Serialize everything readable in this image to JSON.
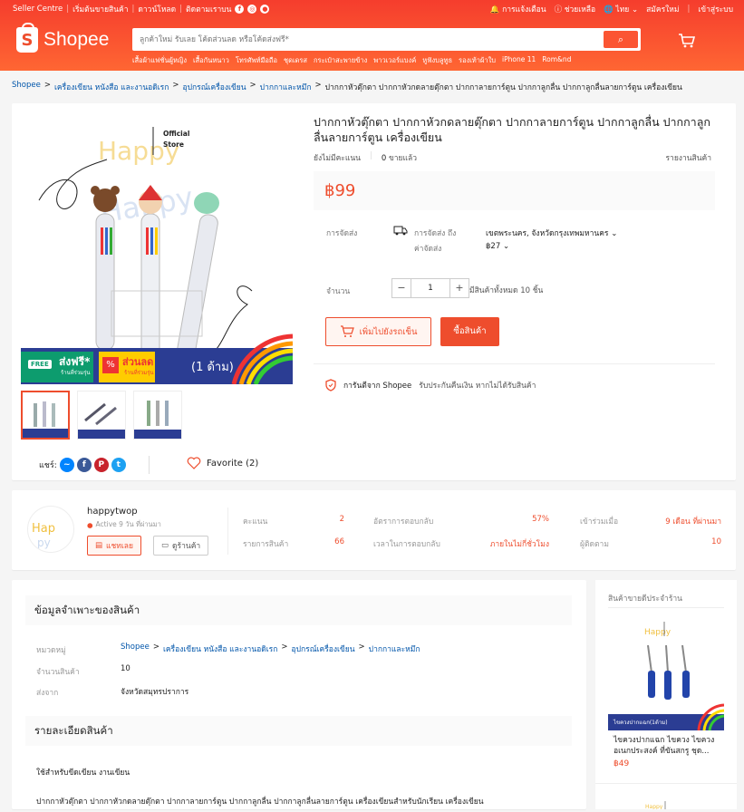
{
  "header": {
    "top_left": [
      "Seller Centre",
      "เริ่มต้นขายสินค้า",
      "ดาวน์โหลด",
      "ติดตามเราบน"
    ],
    "top_right": {
      "notify": "การแจ้งเตือน",
      "help": "ช่วยเหลือ",
      "lang": "ไทย",
      "signup": "สมัครใหม่",
      "login": "เข้าสู่ระบบ"
    },
    "logo": "Shopee",
    "search_placeholder": "ลูกค้าใหม่ รับเลย โค้ดส่วนลด หรือโค้ดส่งฟรี*",
    "keywords": [
      "เสื้อผ้าแฟชั่นผู้หญิง",
      "เสื้อกันหนาว",
      "โทรศัพท์มือถือ",
      "ชุดเดรส",
      "กระเป๋าสะพายข้าง",
      "พาวเวอร์แบงค์",
      "หูฟังบลูทูธ",
      "รองเท้าผ้าใบ",
      "iPhone 11",
      "Rom&nd"
    ]
  },
  "breadcrumb": [
    "Shopee",
    "เครื่องเขียน หนังสือ และงานอดิเรก",
    "อุปกรณ์เครื่องเขียน",
    "ปากกาและหมึก",
    "ปากกาหัวตุ๊กตา ปากกาหัวกดลายตุ๊กตา ปากกาลายการ์ตูน ปากกาลูกลื่น ปากกาลูกลื่นลายการ์ตูน เครื่องเขียน"
  ],
  "product": {
    "title": "ปากกาหัวตุ๊กตา ปากกาหัวกดลายตุ๊กตา ปากกาลายการ์ตูน ปากกาลูกลื่น ปากกาลูกลื่นลายการ์ตูน เครื่องเขียน",
    "rating": "ยังไม่มีคะแนน",
    "sold_count": "0",
    "sold_label": "ขายแล้ว",
    "report": "รายงานสินค้า",
    "price": "฿99",
    "shipping_label": "การจัดส่ง",
    "ship_to_label": "การจัดส่ง ถึง",
    "ship_to": "เขตพระนคร, จังหวัดกรุงเทพมหานคร",
    "ship_cost_label": "ค่าจัดส่ง",
    "ship_cost": "฿27",
    "qty_label": "จำนวน",
    "qty": "1",
    "stock": "มีสินค้าทั้งหมด 10 ชิ้น",
    "add_cart": "เพิ่มไปยังรถเข็น",
    "buy_now": "ซื้อสินค้า",
    "guarantee": "การันตีจาก Shopee",
    "guarantee_text": "รับประกันคืนเงิน หากไม่ได้รับสินค้า",
    "image": {
      "official": "Official",
      "store": "Store",
      "free": "FREE",
      "free_ship": "ส่งฟรี*",
      "free_sub": "ร้านที่ร่วมรุ่น",
      "discount": "ส่วนลด",
      "discount_sub": "ร้านที่ร่วมรุ่น",
      "banner_tail": "1 ด้าม)"
    },
    "share_label": "แชร์:",
    "favorite": "Favorite (2)"
  },
  "shop": {
    "name": "happytwop",
    "active": "Active 9 วัน ที่ผ่านมา",
    "chat": "แชทเลย",
    "view": "ดูร้านค้า",
    "stats": [
      {
        "k": "คะแนน",
        "v": "2"
      },
      {
        "k": "อัตราการตอบกลับ",
        "v": "57%"
      },
      {
        "k": "เข้าร่วมเมื่อ",
        "v": "9 เดือน ที่ผ่านมา"
      },
      {
        "k": "รายการสินค้า",
        "v": "66"
      },
      {
        "k": "เวลาในการตอบกลับ",
        "v": "ภายในไม่กี่ชั่วโมง"
      },
      {
        "k": "ผู้ติดตาม",
        "v": "10"
      }
    ]
  },
  "specs": {
    "heading": "ข้อมูลจำเพาะของสินค้า",
    "category_label": "หมวดหมู่",
    "category": [
      "Shopee",
      "เครื่องเขียน หนังสือ และงานอดิเรก",
      "อุปกรณ์เครื่องเขียน",
      "ปากกาและหมึก"
    ],
    "stock_label": "จำนวนสินค้า",
    "stock": "10",
    "from_label": "ส่งจาก",
    "from": "จังหวัดสมุทรปราการ"
  },
  "description": {
    "heading": "รายละเอียดสินค้า",
    "line1": "ใช้สำหรับขีดเขียน งานเขียน",
    "line2": "ปากกาหัวตุ๊กตา ปากกาหัวกดลายตุ๊กตา ปากกาลายการ์ตูน ปากกาลูกลื่น ปากกาลูกลื่นลายการ์ตูน เครื่องเขียนสำหรับนักเรียน เครื่องเขียน"
  },
  "sidebar": {
    "heading": "สินค้าขายดีประจำร้าน",
    "item_name": "ไขควงปากแฉก ไขควง ไขควงอเนกประสงค์ ที่ขันสกรู ชุด...",
    "item_price": "฿49",
    "item_banner": "ไขควงปากแฉก(1ด้าม)"
  }
}
